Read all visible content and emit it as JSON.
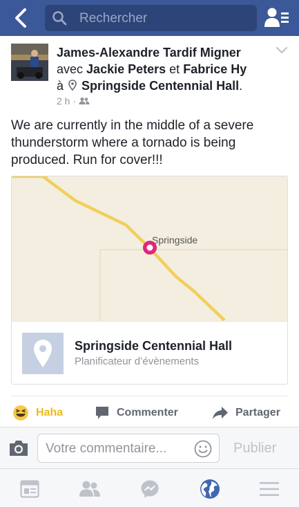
{
  "header": {
    "search_placeholder": "Rechercher"
  },
  "post": {
    "author": "James-Alexandre Tardif Migner",
    "with_word": "avec",
    "tagged": [
      "Jackie Peters",
      "Fabrice Hy"
    ],
    "and_word": "et",
    "at_word": "à",
    "location": "Springside Centennial Hall",
    "location_suffix": ".",
    "time": "2 h",
    "separator": "·",
    "privacy_icon": "friends-icon",
    "text": "We are currently in the middle of a severe thunderstorm where a tornado is being produced.  Run for cover!!!"
  },
  "map_card": {
    "map_label": "Springside",
    "place_name": "Springside Centennial Hall",
    "place_category": "Planificateur d’évènements",
    "pin_color": "#e0257a",
    "road_color": "#f2cf5b"
  },
  "actions": {
    "haha_label": "Haha",
    "comment_label": "Commenter",
    "share_label": "Partager"
  },
  "comment_bar": {
    "placeholder": "Votre commentaire...",
    "publish_label": "Publier"
  },
  "bottom_nav": {
    "items": [
      "news-feed-icon",
      "friends-icon",
      "messenger-icon",
      "globe-notifications-icon",
      "menu-icon"
    ],
    "active_color": "#4267b2"
  },
  "colors": {
    "brand": "#3b5998",
    "search_bg": "#2d4479"
  }
}
